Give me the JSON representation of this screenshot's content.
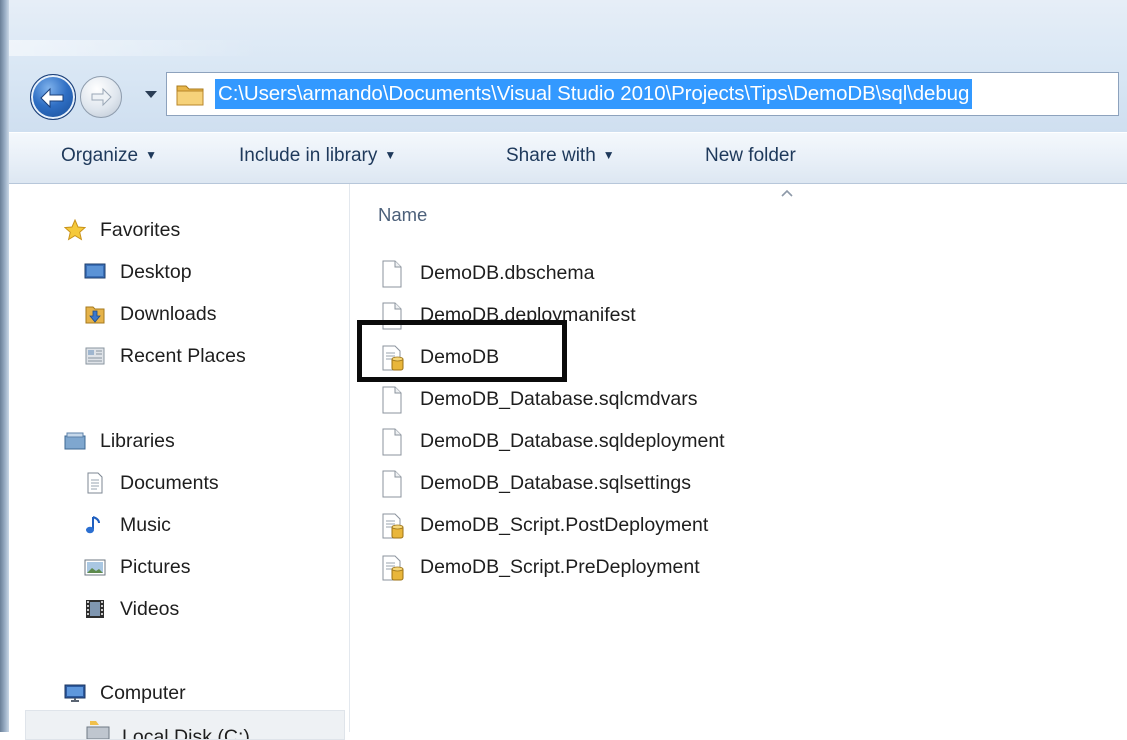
{
  "address_bar": {
    "path": "C:\\Users\\armando\\Documents\\Visual Studio 2010\\Projects\\Tips\\DemoDB\\sql\\debug"
  },
  "toolbar": {
    "organize": "Organize",
    "include_in_library": "Include in library",
    "share_with": "Share with",
    "new_folder": "New folder"
  },
  "navigation": {
    "favorites": {
      "label": "Favorites",
      "items": [
        "Desktop",
        "Downloads",
        "Recent Places"
      ]
    },
    "libraries": {
      "label": "Libraries",
      "items": [
        "Documents",
        "Music",
        "Pictures",
        "Videos"
      ]
    },
    "computer": {
      "label": "Computer",
      "partial_item": "Local Disk (C:)"
    }
  },
  "file_list": {
    "column_header": "Name",
    "files": [
      {
        "name": "DemoDB.dbschema",
        "icon": "blank-file-icon"
      },
      {
        "name": "DemoDB.deploymanifest",
        "icon": "blank-file-icon"
      },
      {
        "name": "DemoDB",
        "icon": "sql-database-file-icon"
      },
      {
        "name": "DemoDB_Database.sqlcmdvars",
        "icon": "blank-file-icon"
      },
      {
        "name": "DemoDB_Database.sqldeployment",
        "icon": "blank-file-icon"
      },
      {
        "name": "DemoDB_Database.sqlsettings",
        "icon": "blank-file-icon"
      },
      {
        "name": "DemoDB_Script.PostDeployment",
        "icon": "sql-script-file-icon"
      },
      {
        "name": "DemoDB_Script.PreDeployment",
        "icon": "sql-script-file-icon"
      }
    ]
  },
  "colors": {
    "selection": "#3399ff",
    "command_text": "#1e395b",
    "highlight_box": "#0b0b0b"
  }
}
